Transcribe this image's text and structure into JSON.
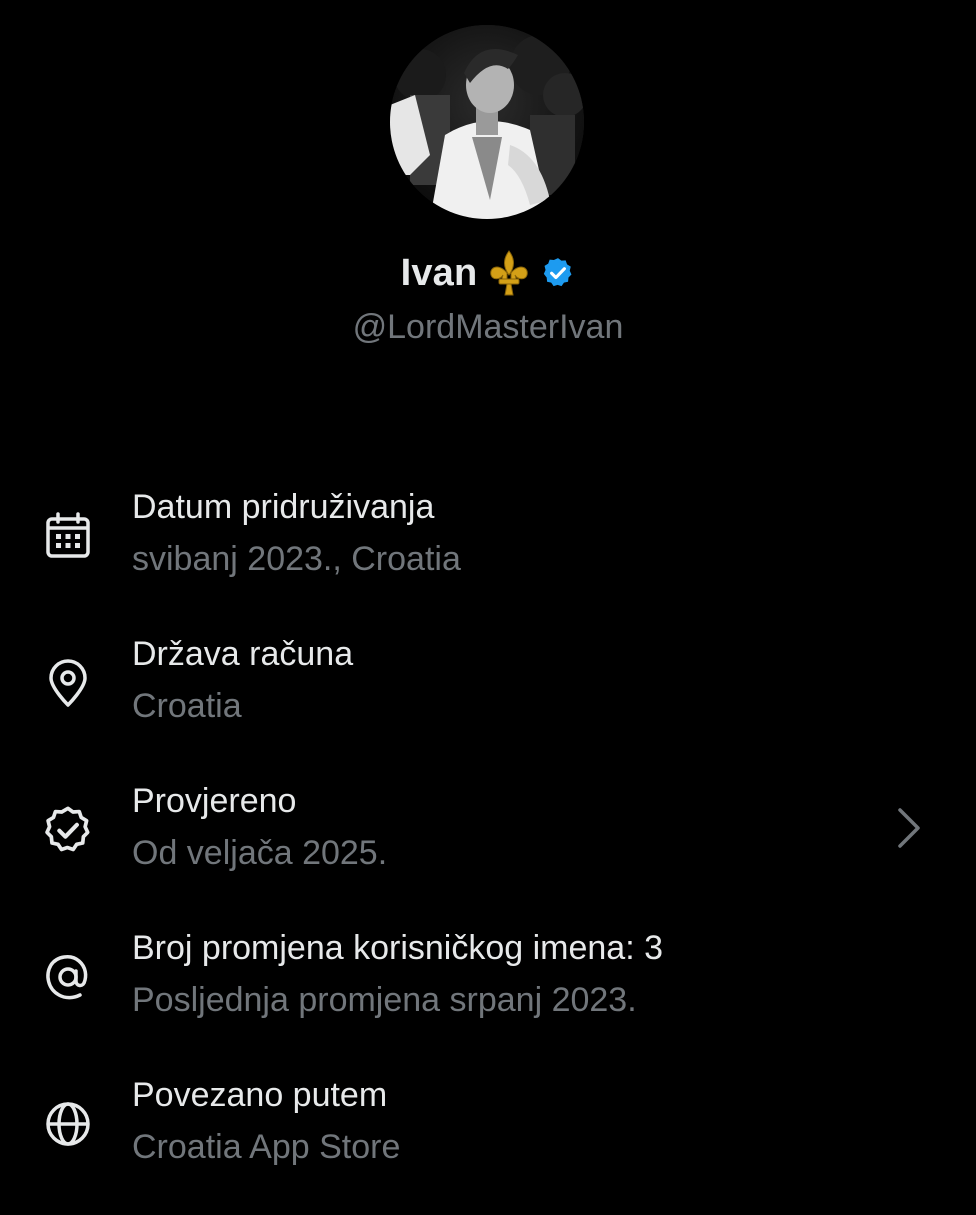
{
  "profile": {
    "display_name": "Ivan",
    "emoji": "fleur-de-lis-icon",
    "verified_badge": "verified-icon",
    "handle": "@LordMasterIvan"
  },
  "rows": [
    {
      "icon": "calendar-icon",
      "title": "Datum pridruživanja",
      "subtitle": "svibanj 2023., Croatia"
    },
    {
      "icon": "location-pin-icon",
      "title": "Država računa",
      "subtitle": "Croatia"
    },
    {
      "icon": "verified-badge-outline-icon",
      "title": "Provjereno",
      "subtitle": "Od veljača 2025.",
      "has_chevron": true
    },
    {
      "icon": "at-sign-icon",
      "title": "Broj promjena korisničkog imena: 3",
      "subtitle": "Posljednja promjena srpanj 2023."
    },
    {
      "icon": "globe-icon",
      "title": "Povezano putem",
      "subtitle": "Croatia App Store"
    }
  ],
  "colors": {
    "background": "#000000",
    "primary_text": "#e7e9ea",
    "secondary_text": "#71767b",
    "verified_blue": "#1d9bf0",
    "emoji_gold": "#d4a017"
  }
}
